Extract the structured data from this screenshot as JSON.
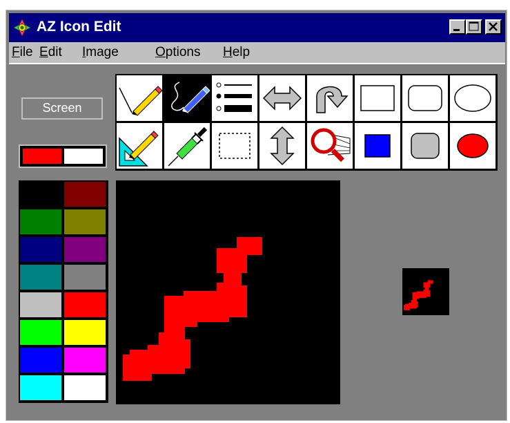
{
  "window": {
    "title": "AZ Icon Edit"
  },
  "title_buttons": [
    {
      "name": "minimize-button",
      "label": "_"
    },
    {
      "name": "maximize-button",
      "label": "□"
    },
    {
      "name": "close-button",
      "label": "×"
    }
  ],
  "menu": [
    {
      "underline": "F",
      "rest": "ile"
    },
    {
      "underline": "E",
      "rest": "dit"
    },
    {
      "underline": "I",
      "rest": "mage"
    },
    {
      "underline": "O",
      "rest": "ptions"
    },
    {
      "underline": "H",
      "rest": "elp"
    }
  ],
  "screen_button": {
    "label": "Screen"
  },
  "colors": {
    "foreground": "#ff0000",
    "background": "#ffffff",
    "title_bar": "#000080"
  },
  "palette": [
    "#000000",
    "#800000",
    "#008000",
    "#808000",
    "#000080",
    "#800080",
    "#008080",
    "#808080",
    "#c0c0c0",
    "#ff0000",
    "#00ff00",
    "#ffff00",
    "#0000ff",
    "#ff00ff",
    "#00ffff",
    "#ffffff"
  ],
  "tools": [
    {
      "name": "pencil-tool-icon",
      "selected": false
    },
    {
      "name": "freehand-pen-tool-icon",
      "selected": true
    },
    {
      "name": "line-width-tool-icon",
      "selected": false
    },
    {
      "name": "flip-horizontal-tool-icon",
      "selected": false
    },
    {
      "name": "rotate-tool-icon",
      "selected": false
    },
    {
      "name": "rectangle-outline-tool-icon",
      "selected": false
    },
    {
      "name": "rounded-rectangle-outline-tool-icon",
      "selected": false
    },
    {
      "name": "ellipse-outline-tool-icon",
      "selected": false
    },
    {
      "name": "line-tool-icon",
      "selected": false
    },
    {
      "name": "color-picker-dropper-tool-icon",
      "selected": false
    },
    {
      "name": "selection-rectangle-tool-icon",
      "selected": false
    },
    {
      "name": "flip-vertical-tool-icon",
      "selected": false
    },
    {
      "name": "zoom-magnifier-tool-icon",
      "selected": false
    },
    {
      "name": "filled-rectangle-tool-icon",
      "selected": false
    },
    {
      "name": "filled-rounded-rectangle-tool-icon",
      "selected": false
    },
    {
      "name": "filled-ellipse-tool-icon",
      "selected": false
    }
  ],
  "icon_image": {
    "fill_color": "#000000",
    "drawing_color": "#ff0000"
  }
}
